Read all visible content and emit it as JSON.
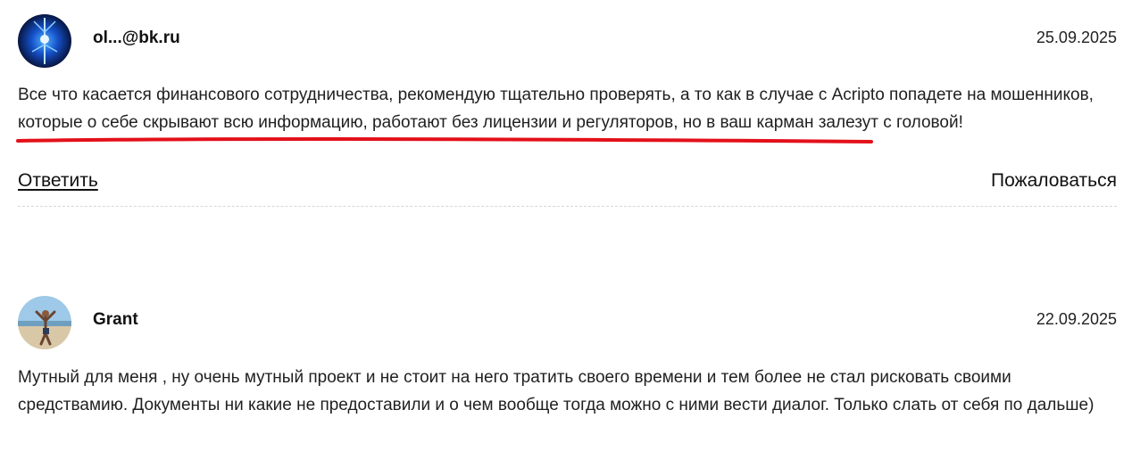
{
  "reviews": [
    {
      "author": "ol...@bk.ru",
      "date": "25.09.2025",
      "text": "Все что касается финансового сотрудничества, рекомендую тщательно проверять, а то как в случае с Acripto попадете на мошенников, которые о себе скрывают всю информацию, работают без лицензии и регуляторов, но в ваш карман залезут с головой!",
      "reply_label": "Ответить",
      "report_label": "Пожаловаться"
    },
    {
      "author": "Grant",
      "date": "22.09.2025",
      "text": "Мутный для меня , ну очень мутный проект и не стоит на него тратить своего времени и тем более не стал рисковать своими средствамию. Документы ни какие не предоставили и о чем вообще тогда можно с ними вести диалог. Только слать от себя по дальше)"
    }
  ],
  "colors": {
    "highlight_underline": "#e3101a",
    "divider": "#d6d6d6"
  }
}
